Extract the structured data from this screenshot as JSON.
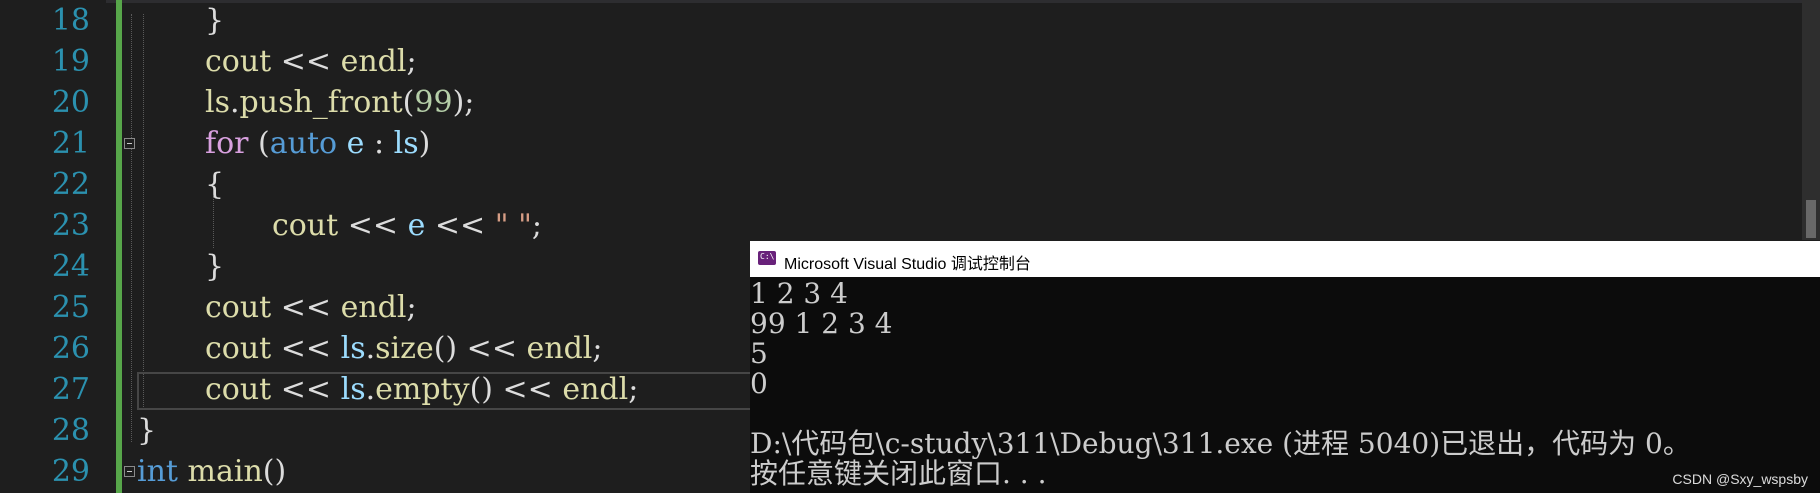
{
  "editor": {
    "lines": [
      {
        "num": "18",
        "code": "}"
      },
      {
        "num": "19",
        "code": "cout << endl;"
      },
      {
        "num": "20",
        "code": "ls.push_front(99);"
      },
      {
        "num": "21",
        "code": "for (auto e : ls)"
      },
      {
        "num": "22",
        "code": "{"
      },
      {
        "num": "23",
        "code": "cout << e << \" \";"
      },
      {
        "num": "24",
        "code": "}"
      },
      {
        "num": "25",
        "code": "cout << endl;"
      },
      {
        "num": "26",
        "code": "cout << ls.size() << endl;"
      },
      {
        "num": "27",
        "code": "cout << ls.empty() << endl;"
      },
      {
        "num": "28",
        "code": "}"
      },
      {
        "num": "29",
        "code": "int main()"
      }
    ],
    "tokens": {
      "l18": [
        "}"
      ],
      "l19": [
        "cout",
        " << ",
        "endl",
        ";"
      ],
      "l20": [
        "ls",
        ".",
        "push_front",
        "(",
        "99",
        ");"
      ],
      "l21": [
        "for",
        " (",
        "auto",
        " ",
        "e",
        " : ",
        "ls",
        ")"
      ],
      "l22": [
        "{"
      ],
      "l23": [
        "cout",
        " << ",
        "e",
        " << ",
        "\" \"",
        ";"
      ],
      "l24": [
        "}"
      ],
      "l25": [
        "cout",
        " << ",
        "endl",
        ";"
      ],
      "l26": [
        "cout",
        " << ",
        "ls",
        ".",
        "size",
        "()",
        " << ",
        "endl",
        ";"
      ],
      "l27": [
        "cout",
        " << ",
        "ls",
        ".",
        "empty",
        "()",
        " << ",
        "endl",
        ";"
      ],
      "l28": [
        "}"
      ],
      "l29": [
        "int",
        " ",
        "main",
        "()"
      ]
    },
    "colors": {
      "line_number": "#2b91af",
      "keyword": "#569cd6",
      "function": "#dcdcaa",
      "identifier": "#9cdcfe",
      "number": "#b5cea8",
      "string": "#d69d85",
      "change_bar": "#57a64a"
    },
    "icons": [
      "fold-collapse-icon"
    ]
  },
  "console": {
    "title": "Microsoft Visual Studio 调试控制台",
    "icon": "vs-console-icon",
    "output": [
      "1 2 3 4",
      "99 1 2 3 4",
      "5",
      "0",
      "",
      "D:\\代码包\\c-study\\311\\Debug\\311.exe (进程 5040)已退出，代码为 0。",
      "按任意键关闭此窗口. . ."
    ]
  },
  "watermark": "CSDN @Sxy_wspsby"
}
